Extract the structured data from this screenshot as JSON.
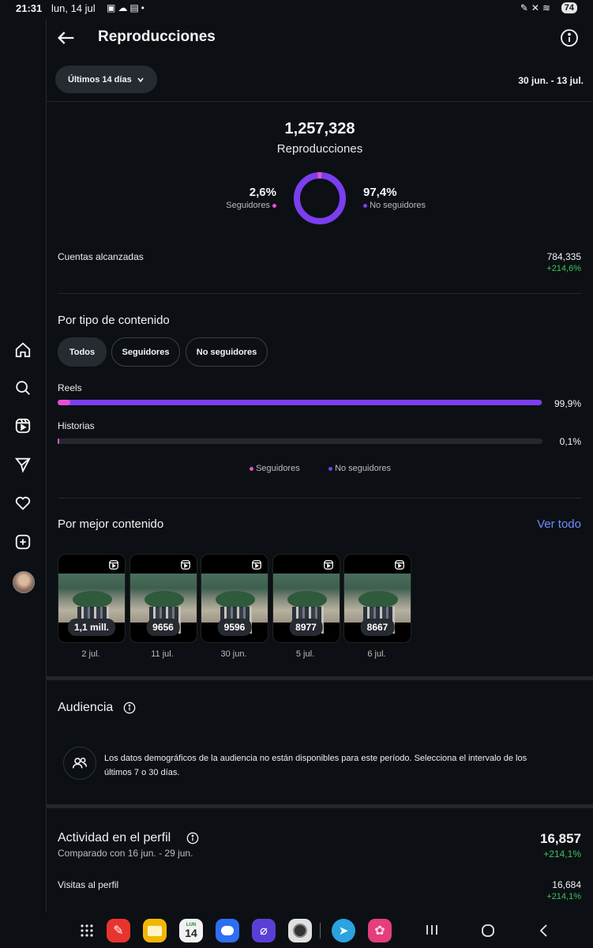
{
  "status_bar": {
    "time": "21:31",
    "date": "lun, 14 jul",
    "battery": "74"
  },
  "header": {
    "title": "Reproducciones"
  },
  "filter": {
    "range_button": "Últimos 14 días",
    "range_text": "30 jun. - 13 jul."
  },
  "summary": {
    "total": "1,257,328",
    "total_label": "Reproducciones",
    "followers_pct": "2,6%",
    "followers_label": "Seguidores",
    "nonfollowers_pct": "97,4%",
    "nonfollowers_label": "No seguidores",
    "followers_fraction": 0.026
  },
  "accounts_reached": {
    "label": "Cuentas alcanzadas",
    "value": "784,335",
    "change": "+214,6%"
  },
  "content_type": {
    "title": "Por tipo de contenido",
    "chips": [
      "Todos",
      "Seguidores",
      "No seguidores"
    ],
    "rows": [
      {
        "label": "Reels",
        "value": "99,9%",
        "total": 0.999,
        "followers": 0.026
      },
      {
        "label": "Historias",
        "value": "0,1%",
        "total": 0.001,
        "followers": 0.001
      }
    ],
    "legend": [
      "Seguidores",
      "No seguidores"
    ]
  },
  "top_content": {
    "title": "Por mejor contenido",
    "see_all": "Ver todo",
    "items": [
      {
        "count": "1,1 mill.",
        "date": "2 jul."
      },
      {
        "count": "9656",
        "date": "11 jul."
      },
      {
        "count": "9596",
        "date": "30 jun."
      },
      {
        "count": "8977",
        "date": "5 jul."
      },
      {
        "count": "8667",
        "date": "6 jul."
      }
    ]
  },
  "audience": {
    "title": "Audiencia",
    "message": "Los datos demográficos de la audiencia no están disponibles para este período. Selecciona el intervalo de los últimos 7 o 30 días."
  },
  "profile_activity": {
    "title": "Actividad en el perfil",
    "subtitle": "Comparado con 16 jun. - 29 jun.",
    "value": "16,857",
    "change": "+214,1%",
    "visits_label": "Visitas al perfil",
    "visits_value": "16,684",
    "visits_change": "+214,1%"
  },
  "nav_dock": {
    "calendar_day": "14",
    "calendar_weekday": "LUN"
  },
  "colors": {
    "followers": "#e84fd4",
    "nonfollowers": "#7b3ef0",
    "positive": "#3ec15a",
    "link": "#6f8cff"
  }
}
